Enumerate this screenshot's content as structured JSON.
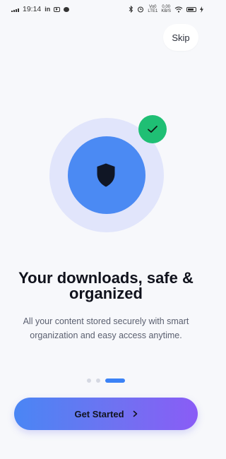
{
  "status_bar": {
    "time": "19:14",
    "linkedin": "in",
    "data_speed_value": "0.00",
    "data_speed_unit": "KB/S",
    "network_top": "Vo0",
    "network_bottom": "LTE1"
  },
  "skip_label": "Skip",
  "illustration": {
    "main_icon": "shield-icon",
    "badge_icon": "check-icon",
    "ring_color": "#e1e5fb",
    "circle_color": "#4b8af3",
    "badge_color": "#1fbf74"
  },
  "headline": "Your downloads, safe & organized",
  "description": "All your content stored securely with smart organization and easy access anytime.",
  "pagination": {
    "total": 3,
    "active_index": 2
  },
  "cta_label": "Get Started",
  "colors": {
    "accent": "#3b82f6",
    "gradient_end": "#8a5cf6",
    "background": "#f7f8fb"
  }
}
